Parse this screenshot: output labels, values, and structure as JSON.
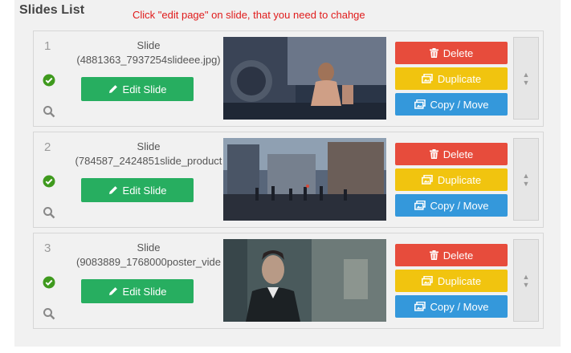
{
  "panel": {
    "title": "Slides List",
    "annotation": "Click \"edit page\" on slide, that you need to chahge"
  },
  "colors": {
    "edit": "#27ae60",
    "delete": "#e74c3c",
    "duplicate": "#f1c40f",
    "copy_move": "#3498db",
    "annotation": "#e01b1b"
  },
  "buttons": {
    "edit": "Edit Slide",
    "delete": "Delete",
    "duplicate": "Duplicate",
    "copy_move": "Copy / Move"
  },
  "icons": {
    "status": "check-circle-icon",
    "preview": "search-icon",
    "edit": "pencil-icon",
    "delete": "trash-icon",
    "duplicate": "duplicate-icon",
    "copy_move": "copy-move-icon",
    "drag": "drag-handle-icon"
  },
  "slides": [
    {
      "number": "1",
      "label": "Slide",
      "filename": "(4881363_7937254slideee.jpg)"
    },
    {
      "number": "2",
      "label": "Slide",
      "filename": "(784587_2424851slide_product"
    },
    {
      "number": "3",
      "label": "Slide",
      "filename": "(9083889_1768000poster_vide"
    }
  ]
}
